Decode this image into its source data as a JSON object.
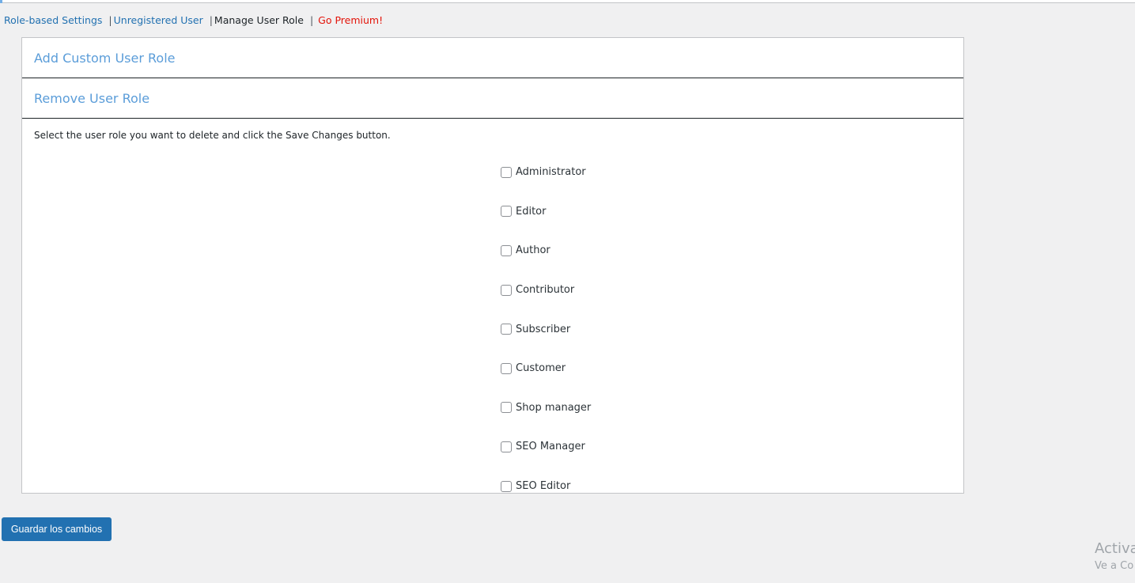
{
  "subnav": {
    "items": [
      {
        "label": "Role-based Settings"
      },
      {
        "label": "Unregistered User"
      },
      {
        "label": "Manage User Role"
      },
      {
        "label": "Go Premium!"
      }
    ],
    "separator": "|"
  },
  "sections": {
    "add_role_title": "Add Custom User Role",
    "remove_role_title": "Remove User Role"
  },
  "instructions": "Select the user role you want to delete and click the Save Changes button.",
  "roles": [
    {
      "label": "Administrator",
      "checked": false
    },
    {
      "label": "Editor",
      "checked": false
    },
    {
      "label": "Author",
      "checked": false
    },
    {
      "label": "Contributor",
      "checked": false
    },
    {
      "label": "Subscriber",
      "checked": false
    },
    {
      "label": "Customer",
      "checked": false
    },
    {
      "label": "Shop manager",
      "checked": false
    },
    {
      "label": "SEO Manager",
      "checked": false
    },
    {
      "label": "SEO Editor",
      "checked": false
    }
  ],
  "save_button": "Guardar los cambios",
  "watermark": {
    "line1": "Activa",
    "line2": "Ve a Co"
  },
  "colors": {
    "link": "#2271b1",
    "premium": "#e3140a",
    "section_title": "#5b9dd9",
    "button_bg": "#2271b1",
    "page_bg": "#f0f0f1"
  }
}
